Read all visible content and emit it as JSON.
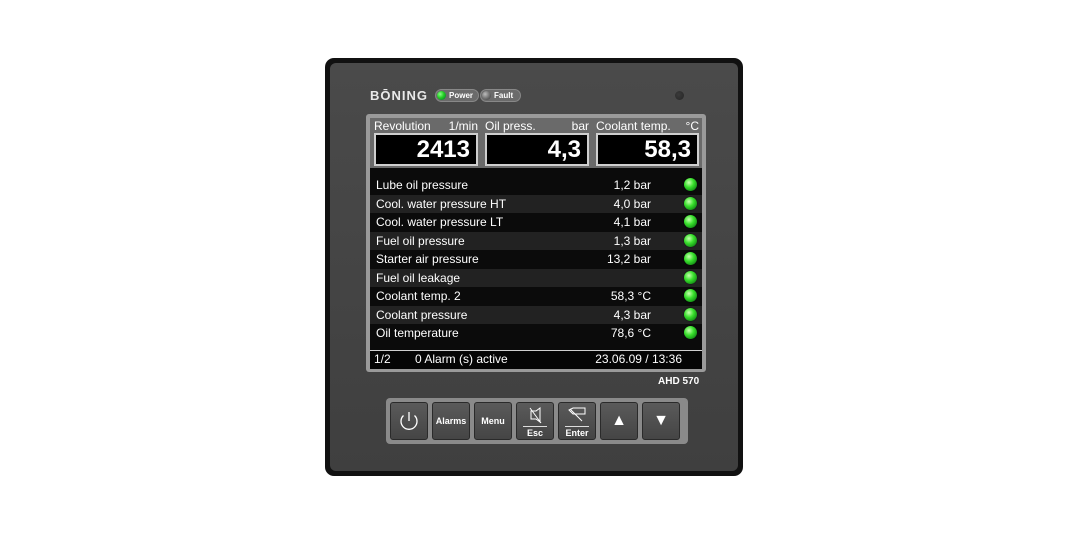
{
  "device": {
    "brand": "BŌNING",
    "model": "AHD 570",
    "indicators": [
      {
        "label": "Power",
        "state": "on",
        "color": "#22cc22"
      },
      {
        "label": "Fault",
        "state": "off",
        "color": "#666666"
      }
    ]
  },
  "gauges": [
    {
      "label": "Revolution",
      "unit": "1/min",
      "value": "2413"
    },
    {
      "label": "Oil press.",
      "unit": "bar",
      "value": "4,3"
    },
    {
      "label": "Coolant temp.",
      "unit": "°C",
      "value": "58,3"
    }
  ],
  "rows": [
    {
      "label": "Lube oil pressure",
      "value": "1,2 bar",
      "status": "ok"
    },
    {
      "label": "Cool. water pressure HT",
      "value": "4,0 bar",
      "status": "ok"
    },
    {
      "label": "Cool. water pressure LT",
      "value": "4,1 bar",
      "status": "ok"
    },
    {
      "label": "Fuel oil pressure",
      "value": "1,3 bar",
      "status": "ok"
    },
    {
      "label": "Starter air pressure",
      "value": "13,2 bar",
      "status": "ok"
    },
    {
      "label": "Fuel oil leakage",
      "value": "",
      "status": "ok"
    },
    {
      "label": "Coolant temp. 2",
      "value": "58,3 °C",
      "status": "ok"
    },
    {
      "label": "Coolant pressure",
      "value": "4,3 bar",
      "status": "ok"
    },
    {
      "label": "Oil temperature",
      "value": "78,6 °C",
      "status": "ok"
    }
  ],
  "footer": {
    "page": "1/2",
    "alarms": "0 Alarm (s) active",
    "datetime": "23.06.09 / 13:36"
  },
  "keys": {
    "power_icon": "power-icon",
    "alarms": "Alarms",
    "menu": "Menu",
    "esc": "Esc",
    "esc_icon": "horn-mute-icon",
    "enter": "Enter",
    "enter_icon": "acknowledge-icon",
    "up_icon": "arrow-up-icon",
    "down_icon": "arrow-down-icon"
  },
  "colors": {
    "led_ok": "#39e02c",
    "screen_bg": "#0b0b0b",
    "row_alt": "#222222"
  }
}
